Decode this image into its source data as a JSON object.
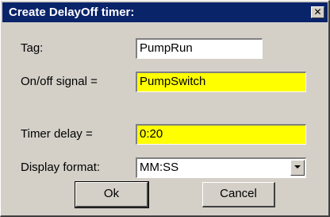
{
  "dialog": {
    "title": "Create DelayOff timer:",
    "close_glyph": "✕"
  },
  "fields": {
    "tag": {
      "label": "Tag:",
      "value": "PumpRun"
    },
    "signal": {
      "label": "On/off signal =",
      "value": "PumpSwitch"
    },
    "delay": {
      "label": "Timer delay =",
      "value": "0:20"
    },
    "format": {
      "label": "Display format:",
      "value": "MM:SS"
    }
  },
  "buttons": {
    "ok": "Ok",
    "cancel": "Cancel"
  },
  "colors": {
    "titlebar": "#0a246a",
    "dialog_bg": "#d4d0c8",
    "highlight_field": "#ffff00"
  },
  "icons": {
    "close": "close-icon",
    "dropdown": "chevron-down-icon"
  }
}
